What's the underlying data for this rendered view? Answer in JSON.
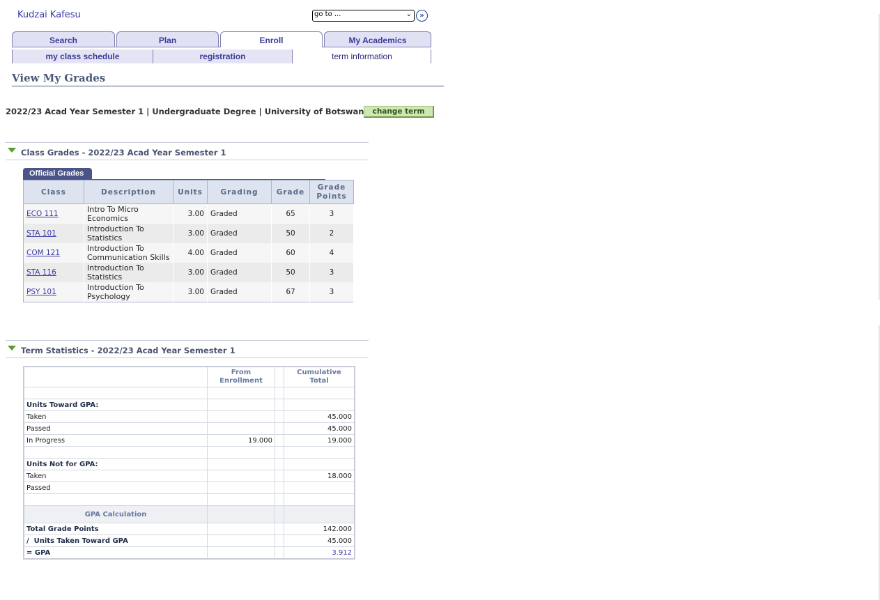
{
  "header": {
    "user_name": "Kudzai Kafesu",
    "goto_selected": "go to ..."
  },
  "tabs": [
    {
      "label": "Search"
    },
    {
      "label": "Plan"
    },
    {
      "label": "Enroll"
    },
    {
      "label": "My Academics"
    }
  ],
  "subtabs": [
    {
      "label": "my class schedule"
    },
    {
      "label": "registration"
    },
    {
      "label": "term information"
    }
  ],
  "page_title": "View My Grades",
  "term": {
    "line": "2022/23 Acad Year Semester 1 | Undergraduate Degree | University of Botswana",
    "change_label": "change term"
  },
  "class_grades": {
    "section_title": "Class Grades - 2022/23 Acad Year Semester 1",
    "grid_tab": "Official Grades",
    "columns": [
      "Class",
      "Description",
      "Units",
      "Grading",
      "Grade",
      "Grade Points"
    ],
    "rows": [
      {
        "class": "ECO 111",
        "description": "Intro To Micro Economics",
        "units": "3.00",
        "grading": "Graded",
        "grade": "65",
        "grade_points": "3"
      },
      {
        "class": "STA 101",
        "description": "Introduction To Statistics",
        "units": "3.00",
        "grading": "Graded",
        "grade": "50",
        "grade_points": "2"
      },
      {
        "class": "COM 121",
        "description": "Introduction To Communication Skills",
        "units": "4.00",
        "grading": "Graded",
        "grade": "60",
        "grade_points": "4"
      },
      {
        "class": "STA 116",
        "description": "Introduction To Statistics",
        "units": "3.00",
        "grading": "Graded",
        "grade": "50",
        "grade_points": "3"
      },
      {
        "class": "PSY 101",
        "description": "Introduction To Psychology",
        "units": "3.00",
        "grading": "Graded",
        "grade": "67",
        "grade_points": "3"
      }
    ]
  },
  "term_stats": {
    "section_title": "Term Statistics - 2022/23 Acad Year Semester 1",
    "col_from": "From Enrollment",
    "col_cum": "Cumulative Total",
    "units_toward_label": "Units Toward GPA:",
    "toward": [
      {
        "label": "Taken",
        "from": "",
        "cum": "45.000"
      },
      {
        "label": "Passed",
        "from": "",
        "cum": "45.000"
      },
      {
        "label": "In Progress",
        "from": "19.000",
        "cum": "19.000"
      }
    ],
    "units_not_label": "Units Not for GPA:",
    "not_for": [
      {
        "label": "Taken",
        "from": "",
        "cum": "18.000"
      },
      {
        "label": "Passed",
        "from": "",
        "cum": ""
      }
    ],
    "gpa_caption": "GPA Calculation",
    "total_points_label": "Total Grade Points",
    "total_points": "142.000",
    "units_taken_label": "/  Units Taken Toward GPA",
    "units_taken": "45.000",
    "gpa_label": "= GPA",
    "gpa": "3.912"
  }
}
